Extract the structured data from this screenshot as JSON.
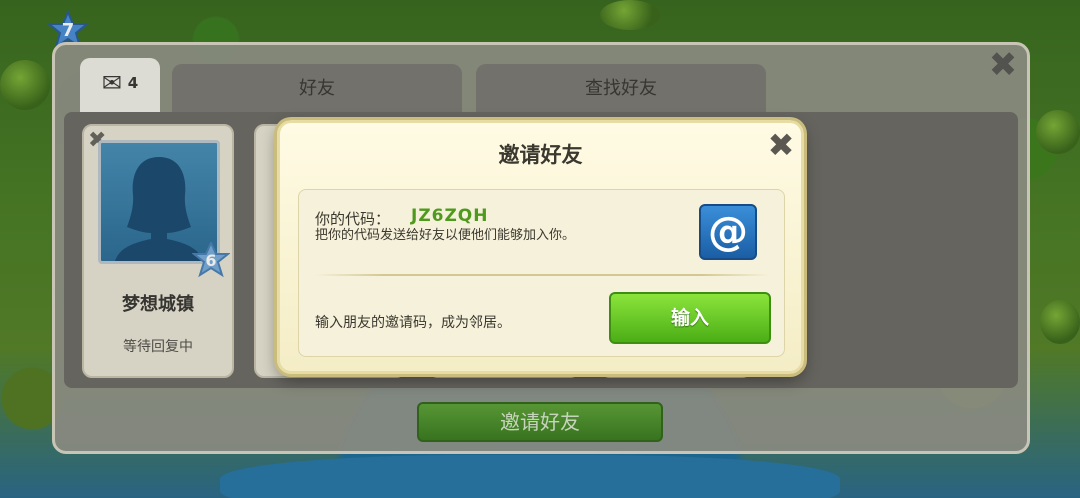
{
  "hud": {
    "level": "7"
  },
  "panel": {
    "close_symbol": "✖",
    "tabs": {
      "mail_icon": "✉",
      "mail_count": "4",
      "friends": "好友",
      "find_friends": "查找好友"
    },
    "friend_cards": [
      {
        "close": "✖",
        "name": "梦想城镇",
        "status": "等待回复中",
        "level": "6"
      }
    ],
    "invite_button": "邀请好友"
  },
  "modal": {
    "title": "邀请好友",
    "close_symbol": "✖",
    "code_label": "你的代码：",
    "code_value": "JZ6ZQH",
    "code_description": "把你的代码发送给好友以便他们能够加入你。",
    "email_icon": "@",
    "enter_description": "输入朋友的邀请码，成为邻居。",
    "enter_button": "输入"
  },
  "colors": {
    "code_green": "#4f9a1e",
    "enter_button_green": "#4bae16",
    "email_button_blue": "#1b5ea5",
    "modal_background": "#fffbe4"
  },
  "icons": [
    "envelope-icon",
    "close-icon",
    "at-email-icon",
    "star-level-icon",
    "avatar-silhouette-icon"
  ]
}
